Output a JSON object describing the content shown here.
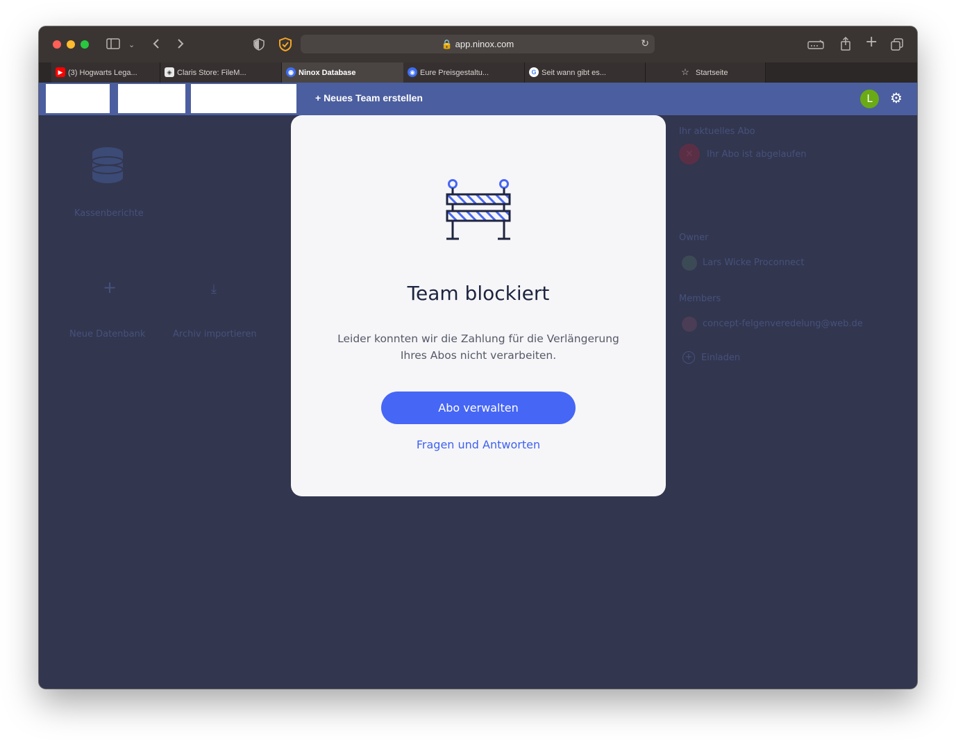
{
  "browser": {
    "url": "app.ninox.com",
    "tabs": [
      {
        "title": "(3) Hogwarts Lega...",
        "icon": "youtube-icon",
        "active": false
      },
      {
        "title": "Claris Store: FileM...",
        "icon": "claris-icon",
        "active": false
      },
      {
        "title": "Ninox Database",
        "icon": "ninox-icon",
        "active": true
      },
      {
        "title": "Eure Preisgestaltu...",
        "icon": "ninox-icon",
        "active": false
      },
      {
        "title": "Seit wann gibt es...",
        "icon": "google-icon",
        "active": false
      },
      {
        "title": "Startseite",
        "icon": "star-icon",
        "active": false
      }
    ]
  },
  "header": {
    "new_team": "+ Neues Team erstellen",
    "avatar_letter": "L"
  },
  "background": {
    "database_name": "Kassenberichte",
    "new_database": "Neue Datenbank",
    "import_archive": "Archiv importieren",
    "subscription_heading": "Ihr aktuelles Abo",
    "subscription_status": "Ihr Abo ist abgelaufen",
    "owner_heading": "Owner",
    "owner_name": "Lars Wicke Proconnect",
    "members_heading": "Members",
    "member_email": "concept-felgenveredelung@web.de",
    "invite": "Einladen"
  },
  "modal": {
    "title": "Team blockiert",
    "text": "Leider konnten wir die Zahlung für die Verlängerung Ihres Abos nicht verarbeiten.",
    "primary_button": "Abo verwalten",
    "secondary_link": "Fragen und Antworten"
  },
  "colors": {
    "accent": "#4666f5",
    "header": "#4b5e9f",
    "overlay": "#32364f",
    "avatar": "#6aaa14"
  }
}
